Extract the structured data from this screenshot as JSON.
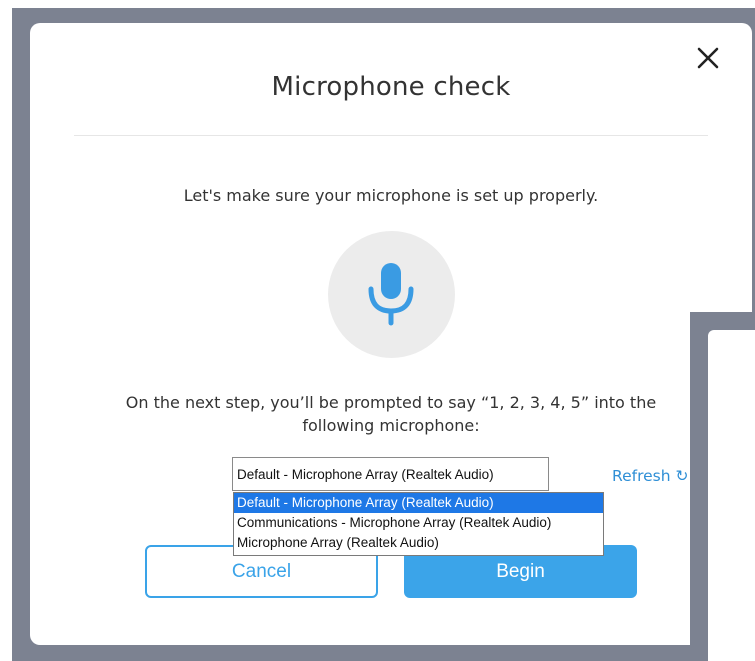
{
  "dialog": {
    "title": "Microphone check",
    "subtitle": "Let's make sure your microphone is set up properly.",
    "prompt_line1": "On the next step, you’ll be prompted to say “1, 2, 3, 4, 5” into the",
    "prompt_line2": "following microphone:",
    "close_icon": "close-icon",
    "mic_icon": "microphone-icon"
  },
  "mic_select": {
    "selected": "Default - Microphone Array (Realtek Audio)",
    "options": [
      "Default - Microphone Array (Realtek Audio)",
      "Communications - Microphone Array (Realtek Audio)",
      "Microphone Array (Realtek Audio)"
    ],
    "highlighted_index": 0
  },
  "refresh_label": "Refresh ↻",
  "buttons": {
    "cancel": "Cancel",
    "begin": "Begin"
  },
  "colors": {
    "accent": "#3ba4e9",
    "highlight": "#1e78e6",
    "backdrop": "#7c8291"
  }
}
